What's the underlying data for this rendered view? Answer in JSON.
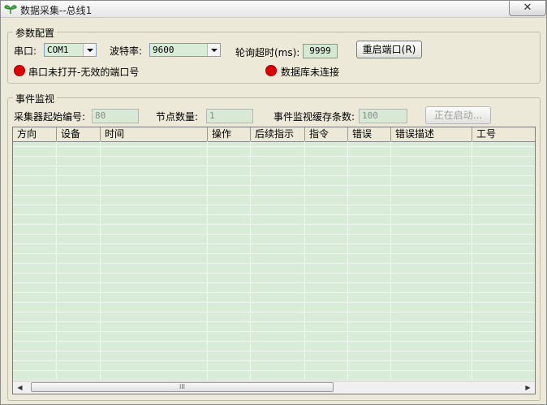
{
  "window": {
    "title": "数据采集--总线1",
    "close_glyph": "✕"
  },
  "config": {
    "legend": "参数配置",
    "port_label": "串口:",
    "port_value": "COM1",
    "baud_label": "波特率:",
    "baud_value": "9600",
    "timeout_label": "轮询超时(ms):",
    "timeout_value": "9999",
    "restart_button": "重启端口(R)",
    "port_status": "串口未打开-无效的端口号",
    "db_status": "数据库未连接",
    "status_color": "#e00000"
  },
  "monitor": {
    "legend": "事件监视",
    "start_no_label": "采集器起始编号:",
    "start_no_value": "80",
    "node_count_label": "节点数量:",
    "node_count_value": "1",
    "cache_label": "事件监视缓存条数:",
    "cache_value": "100",
    "starting_button": "正在启动...",
    "columns": [
      "方向",
      "设备",
      "时间",
      "操作",
      "后续指示",
      "指令",
      "错误",
      "错误描述",
      "工号"
    ],
    "scroll_left": "◀",
    "scroll_right": "▶",
    "scroll_grip": "III"
  }
}
